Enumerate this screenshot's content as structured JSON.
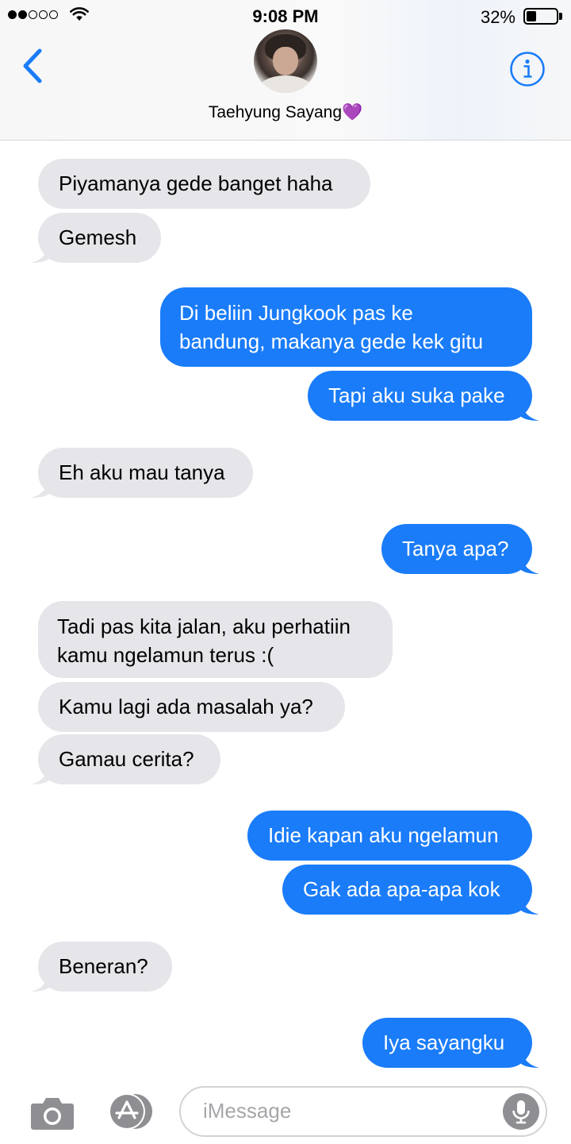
{
  "status_bar": {
    "time": "9:08 PM",
    "battery_percent": "32%",
    "battery_level": 0.32,
    "signal_bars_filled": 2,
    "signal_bars_total": 5
  },
  "header": {
    "contact_name": "Taehyung Sayang💜",
    "back_icon": "chevron-left-icon",
    "info_icon": "info-icon"
  },
  "messages": [
    {
      "direction": "in",
      "lines": [
        "Piyamanya gede banget haha"
      ]
    },
    {
      "direction": "in",
      "lines": [
        "Gemesh"
      ]
    },
    {
      "direction": "out",
      "lines": [
        "Di beliin Jungkook pas ke",
        "bandung, makanya gede kek gitu"
      ]
    },
    {
      "direction": "out",
      "lines": [
        "Tapi aku suka pake"
      ]
    },
    {
      "direction": "in",
      "lines": [
        "Eh aku mau tanya"
      ]
    },
    {
      "direction": "out",
      "lines": [
        "Tanya apa?"
      ]
    },
    {
      "direction": "in",
      "lines": [
        "Tadi pas kita jalan, aku perhatiin",
        "kamu ngelamun terus :("
      ]
    },
    {
      "direction": "in",
      "lines": [
        "Kamu lagi ada masalah ya?"
      ]
    },
    {
      "direction": "in",
      "lines": [
        "Gamau cerita?"
      ]
    },
    {
      "direction": "out",
      "lines": [
        "Idie kapan aku ngelamun"
      ]
    },
    {
      "direction": "out",
      "lines": [
        "Gak ada apa-apa kok"
      ]
    },
    {
      "direction": "in",
      "lines": [
        "Beneran?"
      ]
    },
    {
      "direction": "out",
      "lines": [
        "Iya sayangku"
      ]
    }
  ],
  "composer": {
    "placeholder": "iMessage",
    "camera_icon": "camera-icon",
    "apps_icon": "app-store-icon",
    "mic_icon": "microphone-icon"
  },
  "colors": {
    "accent": "#1a7cf8",
    "incoming_bubble": "#e5e5ea",
    "outgoing_bubble": "#1a7cf8"
  }
}
